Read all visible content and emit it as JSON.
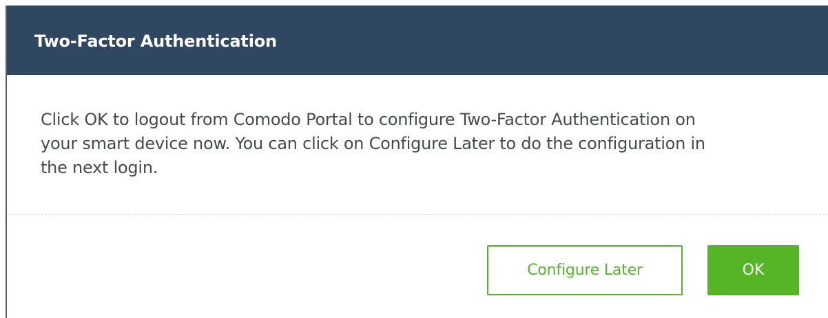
{
  "dialog": {
    "title": "Two-Factor Authentication",
    "message_lines": [
      "Click OK to logout from Comodo Portal to configure Two-Factor Authentication on",
      "your smart device now. You can click on Configure Later to do the configuration in",
      "the next login."
    ],
    "buttons": {
      "configure_later_label": "Configure Later",
      "ok_label": "OK"
    }
  },
  "colors": {
    "header_bg": "#2f4760",
    "accent_green": "#55b525",
    "body_text": "#434a52"
  }
}
